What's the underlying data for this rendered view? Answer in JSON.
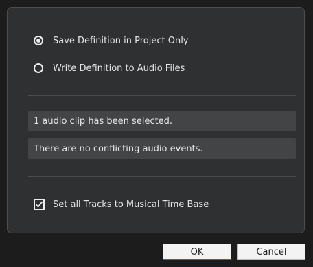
{
  "options": {
    "save_in_project": {
      "label": "Save Definition in Project Only",
      "selected": true
    },
    "write_to_files": {
      "label": "Write Definition to Audio Files",
      "selected": false
    }
  },
  "info": {
    "clips_selected": "1 audio clip has been selected.",
    "conflicts": "There are no conflicting audio events."
  },
  "musical_time_base": {
    "label": "Set all Tracks to Musical Time Base",
    "checked": true
  },
  "buttons": {
    "ok": "OK",
    "cancel": "Cancel"
  }
}
